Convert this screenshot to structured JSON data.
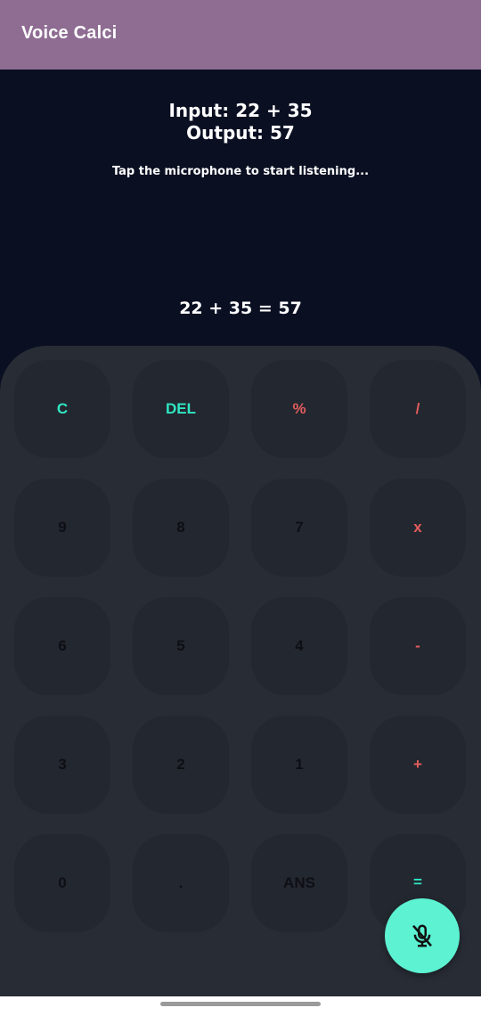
{
  "app": {
    "title": "Voice Calci"
  },
  "display": {
    "input_line": "Input: 22 + 35",
    "output_line": "Output: 57",
    "hint": "Tap the microphone to start listening...",
    "result": "22 + 35  = 57"
  },
  "keys": {
    "clear": "C",
    "delete": "DEL",
    "percent": "%",
    "divide": "/",
    "nine": "9",
    "eight": "8",
    "seven": "7",
    "multiply": "x",
    "six": "6",
    "five": "5",
    "four": "4",
    "minus": "-",
    "three": "3",
    "two": "2",
    "one": "1",
    "plus": "+",
    "zero": "0",
    "dot": ".",
    "ans": "ANS",
    "equals": "="
  },
  "fab": {
    "icon": "mic-off-icon"
  },
  "colors": {
    "app_bar": "#8f6d93",
    "screen_bg": "#0a0f22",
    "keypad_bg": "#282c35",
    "key_bg": "#23272f",
    "teal": "#2fe6c3",
    "red": "#e35d5d",
    "fab": "#5cf2d2"
  }
}
